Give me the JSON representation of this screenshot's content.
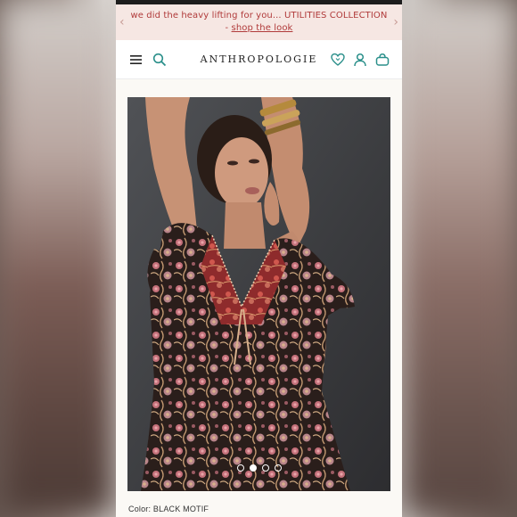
{
  "promo": {
    "message": "we did the heavy lifting for you... UTILITIES COLLECTION - ",
    "link": "shop the look",
    "prev_icon": "chevron-left-icon",
    "next_icon": "chevron-right-icon"
  },
  "header": {
    "logo": "ANTHROPOLOGIE",
    "icons": [
      "menu-icon",
      "search-icon",
      "heart-icon",
      "user-icon",
      "bag-icon"
    ],
    "accent": "#2a8f8a"
  },
  "carousel": {
    "slide_count": 4,
    "active_index": 1
  },
  "product": {
    "color_label": "Color:",
    "color_value": "BLACK MOTIF"
  },
  "colors": {
    "promo_bg": "#f6e7e3",
    "promo_text": "#b03a3a",
    "page_bg": "#fbf9f5"
  }
}
